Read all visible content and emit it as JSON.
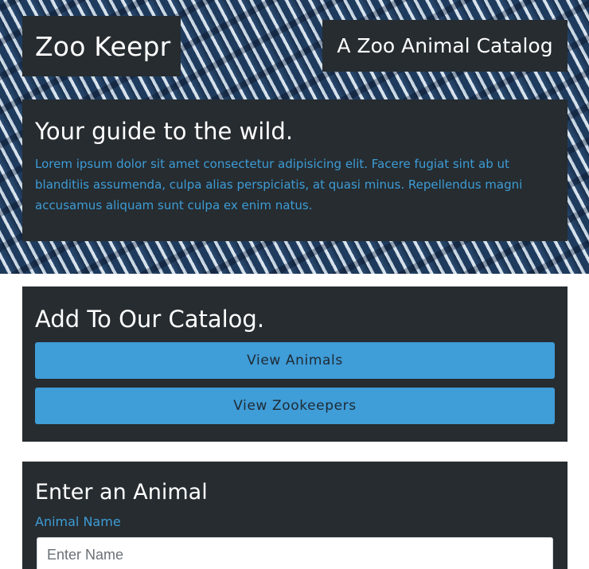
{
  "header": {
    "brand": "Zoo Keepr",
    "tagline": "A Zoo Animal Catalog"
  },
  "intro": {
    "heading": "Your guide to the wild.",
    "body": "Lorem ipsum dolor sit amet consectetur adipisicing elit. Facere fugiat sint ab ut blanditiis assumenda, culpa alias perspiciatis, at quasi minus. Repellendus magni accusamus aliquam sunt culpa ex enim natus."
  },
  "catalog": {
    "heading": "Add To Our Catalog.",
    "buttons": [
      {
        "label": "View Animals"
      },
      {
        "label": "View Zookeepers"
      }
    ]
  },
  "animal_form": {
    "heading": "Enter an Animal",
    "name_label": "Animal Name",
    "name_placeholder": "Enter Name",
    "name_value": ""
  },
  "colors": {
    "panel": "#262c30",
    "accent": "#3f9dd8",
    "link_text": "#3e9cd6"
  }
}
